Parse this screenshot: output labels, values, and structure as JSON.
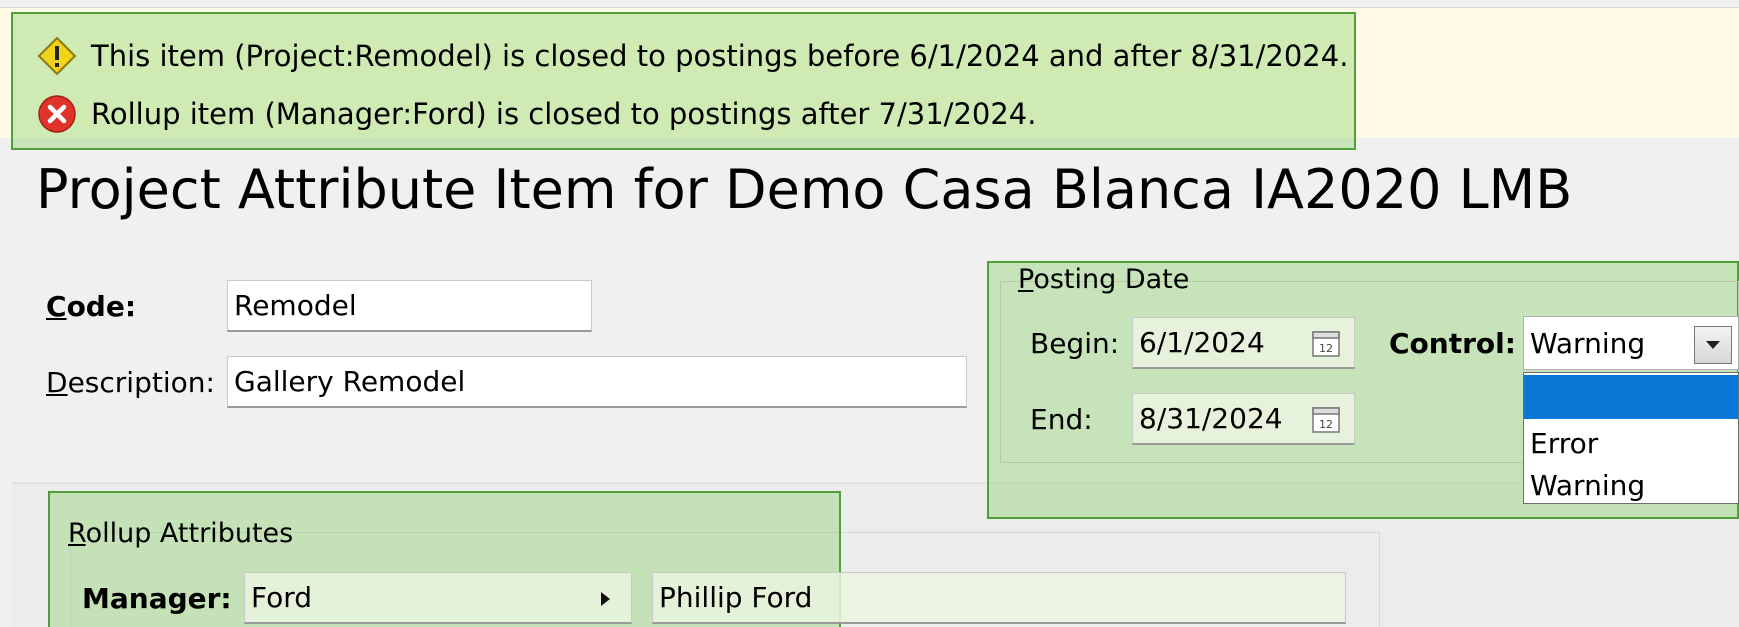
{
  "messages": [
    {
      "icon": "warning-icon",
      "text": "This item (Project:Remodel) is closed to postings before 6/1/2024 and after 8/31/2024."
    },
    {
      "icon": "error-icon",
      "text": "Rollup item (Manager:Ford) is closed to postings after 7/31/2024."
    }
  ],
  "title": "Project Attribute Item for Demo Casa Blanca IA2020 LMB",
  "form": {
    "code_label_prefix": "C",
    "code_label_rest": "ode:",
    "code_value": "Remodel",
    "description_label_prefix": "D",
    "description_label_rest": "escription:",
    "description_value": "Gallery Remodel"
  },
  "posting_date": {
    "legend_prefix": "P",
    "legend_rest": "osting Date",
    "begin_label": "Begin:",
    "begin_value": "6/1/2024",
    "end_label": "End:",
    "end_value": "8/31/2024",
    "control_label": "Control:",
    "control_value": "Warning",
    "control_options": [
      "",
      "Error",
      "Warning"
    ]
  },
  "rollup": {
    "legend_prefix": "R",
    "legend_rest": "ollup Attributes",
    "manager_label": "Manager:",
    "manager_value": "Ford",
    "manager_name": "Phillip Ford"
  },
  "colors": {
    "highlight": "#8cd26e",
    "highlight_border": "#4f9f3a",
    "banner": "#fffbe6",
    "selected_option": "#0a78d7",
    "error_red": "#e0342b",
    "warning_yellow": "#f3d21c"
  }
}
